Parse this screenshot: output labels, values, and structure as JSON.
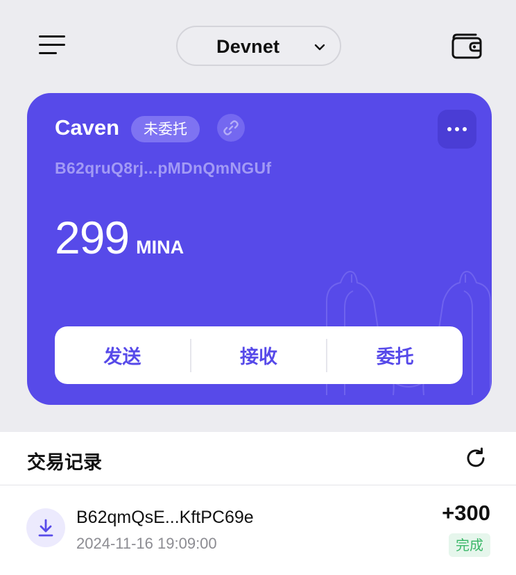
{
  "header": {
    "menu_icon": "hamburger-menu-icon",
    "network": "Devnet",
    "network_chevron_icon": "chevron-down-icon",
    "wallet_icon": "wallet-icon"
  },
  "account_card": {
    "name": "Caven",
    "delegation_status": "未委托",
    "link_icon": "link-icon",
    "more_icon": "more-horizontal-icon",
    "address": "B62qruQ8rj...pMDnQmNGUf",
    "balance_amount": "299",
    "balance_unit": "MINA",
    "background_color": "#574AE9",
    "actions": {
      "send": "发送",
      "receive": "接收",
      "delegate": "委托"
    }
  },
  "transactions": {
    "title": "交易记录",
    "refresh_icon": "refresh-icon",
    "items": [
      {
        "icon": "receive-arrow-icon",
        "address": "B62qmQsE...KftPC69e",
        "time": "2024-11-16 19:09:00",
        "amount": "+300",
        "status": "完成"
      }
    ]
  }
}
